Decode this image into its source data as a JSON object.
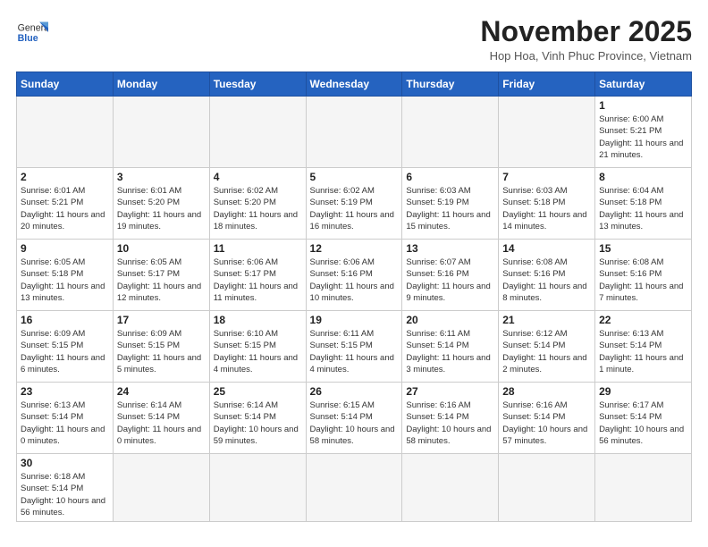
{
  "header": {
    "logo_general": "General",
    "logo_blue": "Blue",
    "month_title": "November 2025",
    "subtitle": "Hop Hoa, Vinh Phuc Province, Vietnam"
  },
  "weekdays": [
    "Sunday",
    "Monday",
    "Tuesday",
    "Wednesday",
    "Thursday",
    "Friday",
    "Saturday"
  ],
  "weeks": [
    [
      {
        "day": "",
        "info": ""
      },
      {
        "day": "",
        "info": ""
      },
      {
        "day": "",
        "info": ""
      },
      {
        "day": "",
        "info": ""
      },
      {
        "day": "",
        "info": ""
      },
      {
        "day": "",
        "info": ""
      },
      {
        "day": "1",
        "info": "Sunrise: 6:00 AM\nSunset: 5:21 PM\nDaylight: 11 hours and 21 minutes."
      }
    ],
    [
      {
        "day": "2",
        "info": "Sunrise: 6:01 AM\nSunset: 5:21 PM\nDaylight: 11 hours and 20 minutes."
      },
      {
        "day": "3",
        "info": "Sunrise: 6:01 AM\nSunset: 5:20 PM\nDaylight: 11 hours and 19 minutes."
      },
      {
        "day": "4",
        "info": "Sunrise: 6:02 AM\nSunset: 5:20 PM\nDaylight: 11 hours and 18 minutes."
      },
      {
        "day": "5",
        "info": "Sunrise: 6:02 AM\nSunset: 5:19 PM\nDaylight: 11 hours and 16 minutes."
      },
      {
        "day": "6",
        "info": "Sunrise: 6:03 AM\nSunset: 5:19 PM\nDaylight: 11 hours and 15 minutes."
      },
      {
        "day": "7",
        "info": "Sunrise: 6:03 AM\nSunset: 5:18 PM\nDaylight: 11 hours and 14 minutes."
      },
      {
        "day": "8",
        "info": "Sunrise: 6:04 AM\nSunset: 5:18 PM\nDaylight: 11 hours and 13 minutes."
      }
    ],
    [
      {
        "day": "9",
        "info": "Sunrise: 6:05 AM\nSunset: 5:18 PM\nDaylight: 11 hours and 13 minutes."
      },
      {
        "day": "10",
        "info": "Sunrise: 6:05 AM\nSunset: 5:17 PM\nDaylight: 11 hours and 12 minutes."
      },
      {
        "day": "11",
        "info": "Sunrise: 6:06 AM\nSunset: 5:17 PM\nDaylight: 11 hours and 11 minutes."
      },
      {
        "day": "12",
        "info": "Sunrise: 6:06 AM\nSunset: 5:16 PM\nDaylight: 11 hours and 10 minutes."
      },
      {
        "day": "13",
        "info": "Sunrise: 6:07 AM\nSunset: 5:16 PM\nDaylight: 11 hours and 9 minutes."
      },
      {
        "day": "14",
        "info": "Sunrise: 6:08 AM\nSunset: 5:16 PM\nDaylight: 11 hours and 8 minutes."
      },
      {
        "day": "15",
        "info": "Sunrise: 6:08 AM\nSunset: 5:16 PM\nDaylight: 11 hours and 7 minutes."
      }
    ],
    [
      {
        "day": "16",
        "info": "Sunrise: 6:09 AM\nSunset: 5:15 PM\nDaylight: 11 hours and 6 minutes."
      },
      {
        "day": "17",
        "info": "Sunrise: 6:09 AM\nSunset: 5:15 PM\nDaylight: 11 hours and 5 minutes."
      },
      {
        "day": "18",
        "info": "Sunrise: 6:10 AM\nSunset: 5:15 PM\nDaylight: 11 hours and 4 minutes."
      },
      {
        "day": "19",
        "info": "Sunrise: 6:11 AM\nSunset: 5:15 PM\nDaylight: 11 hours and 4 minutes."
      },
      {
        "day": "20",
        "info": "Sunrise: 6:11 AM\nSunset: 5:14 PM\nDaylight: 11 hours and 3 minutes."
      },
      {
        "day": "21",
        "info": "Sunrise: 6:12 AM\nSunset: 5:14 PM\nDaylight: 11 hours and 2 minutes."
      },
      {
        "day": "22",
        "info": "Sunrise: 6:13 AM\nSunset: 5:14 PM\nDaylight: 11 hours and 1 minute."
      }
    ],
    [
      {
        "day": "23",
        "info": "Sunrise: 6:13 AM\nSunset: 5:14 PM\nDaylight: 11 hours and 0 minutes."
      },
      {
        "day": "24",
        "info": "Sunrise: 6:14 AM\nSunset: 5:14 PM\nDaylight: 11 hours and 0 minutes."
      },
      {
        "day": "25",
        "info": "Sunrise: 6:14 AM\nSunset: 5:14 PM\nDaylight: 10 hours and 59 minutes."
      },
      {
        "day": "26",
        "info": "Sunrise: 6:15 AM\nSunset: 5:14 PM\nDaylight: 10 hours and 58 minutes."
      },
      {
        "day": "27",
        "info": "Sunrise: 6:16 AM\nSunset: 5:14 PM\nDaylight: 10 hours and 58 minutes."
      },
      {
        "day": "28",
        "info": "Sunrise: 6:16 AM\nSunset: 5:14 PM\nDaylight: 10 hours and 57 minutes."
      },
      {
        "day": "29",
        "info": "Sunrise: 6:17 AM\nSunset: 5:14 PM\nDaylight: 10 hours and 56 minutes."
      }
    ],
    [
      {
        "day": "30",
        "info": "Sunrise: 6:18 AM\nSunset: 5:14 PM\nDaylight: 10 hours and 56 minutes."
      },
      {
        "day": "",
        "info": ""
      },
      {
        "day": "",
        "info": ""
      },
      {
        "day": "",
        "info": ""
      },
      {
        "day": "",
        "info": ""
      },
      {
        "day": "",
        "info": ""
      },
      {
        "day": "",
        "info": ""
      }
    ]
  ]
}
